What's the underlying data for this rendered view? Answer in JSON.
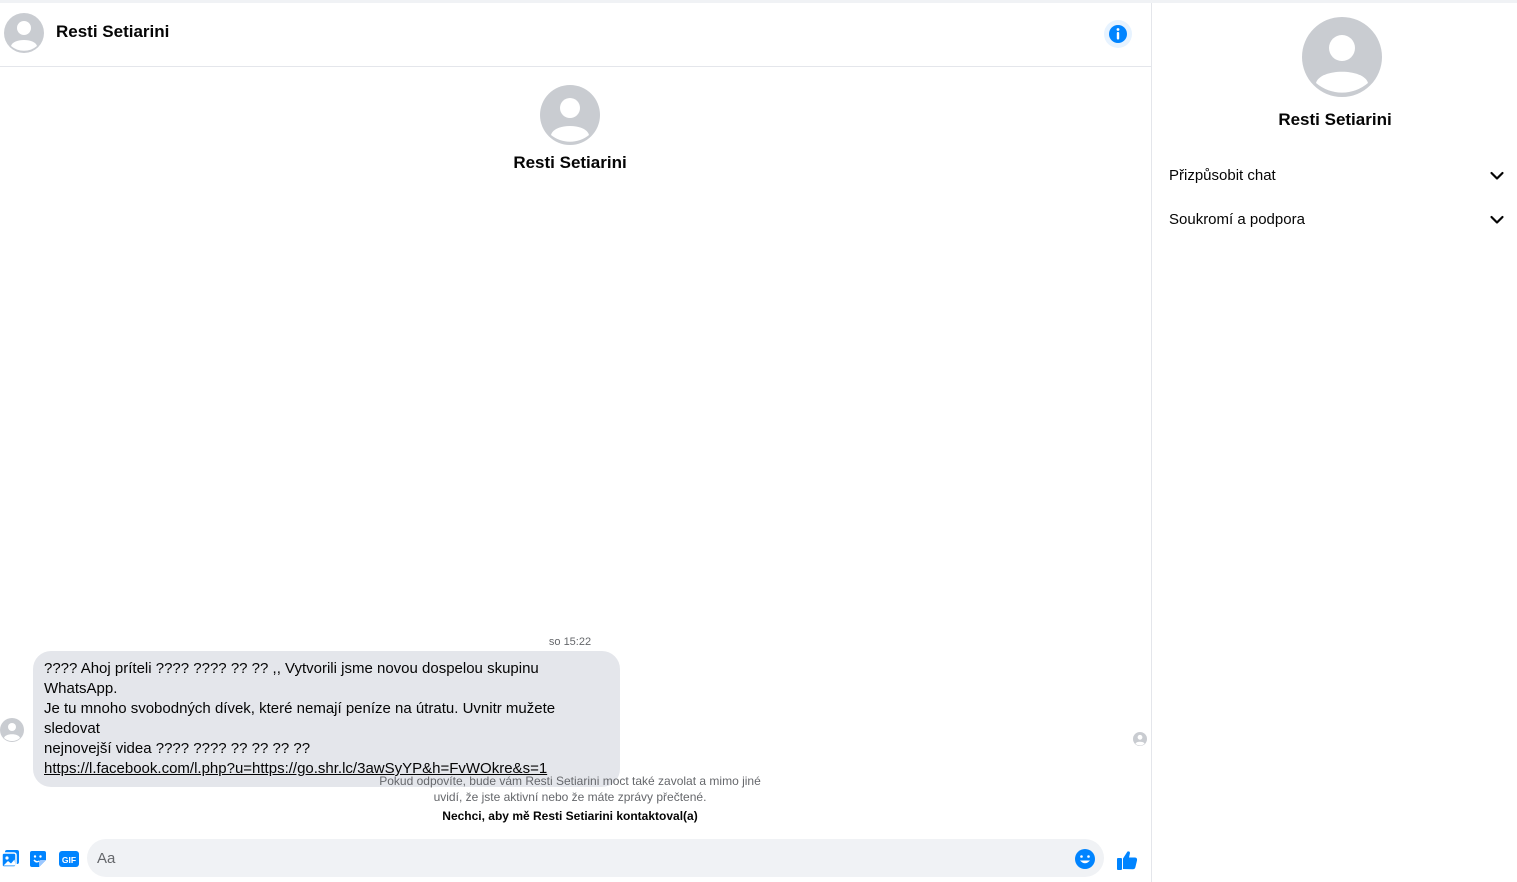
{
  "contact": {
    "name": "Resti Setiarini"
  },
  "header": {
    "info_icon": "info-icon"
  },
  "conversation": {
    "timestamp": "so 15:22",
    "message": {
      "line1": "???? Ahoj príteli ???? ???? ?? ?? ,, Vytvorili jsme novou dospelou skupinu WhatsApp.",
      "line2": "Je tu mnoho svobodných dívek, které nemají peníze na útratu. Uvnitr mužete sledovat",
      "line3": "nejnovejší videa ???? ???? ?? ?? ?? ??",
      "link": "https://l.facebook.com/l.php?u=https://go.shr.lc/3awSyYP&h=FvWOkre&s=1"
    }
  },
  "notice": {
    "line1": "Pokud odpovíte, bude vám Resti Setiarini moct také zavolat a mimo jiné",
    "line2": "uvidí, že jste aktivní nebo že máte zprávy přečtené.",
    "block_link": "Nechci, aby mě Resti Setiarini kontaktoval(a)"
  },
  "composer": {
    "placeholder": "Aa",
    "gif_label": "GIF",
    "icons": [
      "image-icon",
      "sticker-icon",
      "gif-icon",
      "emoji-icon",
      "like-icon"
    ]
  },
  "sidebar": {
    "items": [
      {
        "label": "Přizpůsobit chat"
      },
      {
        "label": "Soukromí a podpora"
      }
    ]
  },
  "colors": {
    "accent": "#0084ff",
    "bubble": "#e4e6eb",
    "input": "#f0f2f5",
    "muted": "#65676b"
  }
}
